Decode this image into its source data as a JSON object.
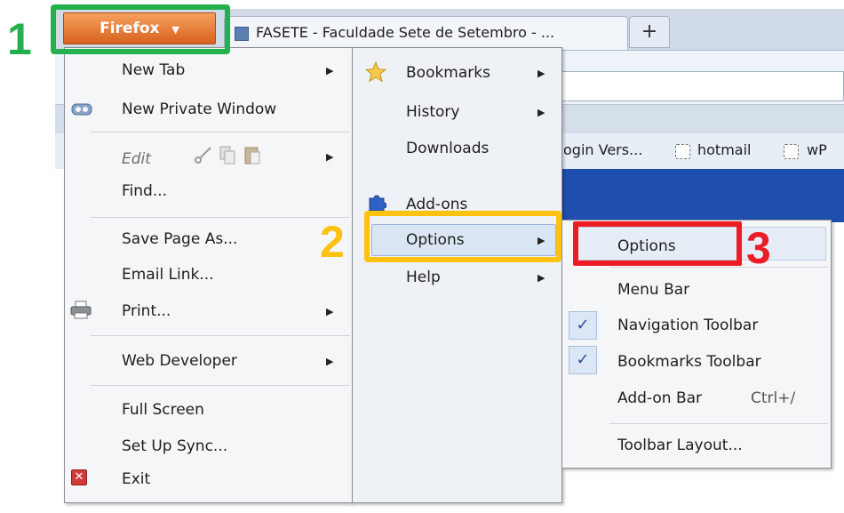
{
  "window": {
    "firefox_button_label": "Firefox",
    "tab_title": "FASETE - Faculdade Sete de Setembro - ...",
    "new_tab_symbol": "+",
    "bookmarks_toolbar_items": [
      "ogin Vers...",
      "hotmail",
      "wP"
    ]
  },
  "left_menu": {
    "new_tab": "New Tab",
    "new_private_window": "New Private Window",
    "edit": "Edit",
    "find": "Find...",
    "save_page_as": "Save Page As...",
    "email_link": "Email Link...",
    "print": "Print...",
    "web_developer": "Web Developer",
    "full_screen": "Full Screen",
    "set_up_sync": "Set Up Sync...",
    "exit": "Exit"
  },
  "middle_menu": {
    "bookmarks": "Bookmarks",
    "history": "History",
    "downloads": "Downloads",
    "addons": "Add-ons",
    "options": "Options",
    "help": "Help"
  },
  "options_submenu": {
    "options": "Options",
    "menu_bar": "Menu Bar",
    "navigation_toolbar": "Navigation Toolbar",
    "bookmarks_toolbar": "Bookmarks Toolbar",
    "addon_bar": "Add-on Bar",
    "addon_bar_shortcut": "Ctrl+/",
    "toolbar_layout": "Toolbar Layout...",
    "checked_items": [
      "Navigation Toolbar",
      "Bookmarks Toolbar"
    ]
  },
  "annotations": {
    "step1": "1",
    "step2": "2",
    "step3": "3",
    "colors": {
      "step1": "#23b14d",
      "step2": "#ffc20e",
      "step3": "#ed1c24"
    }
  },
  "icons": {
    "private_window": "mask-icon",
    "edit_cut": "scissors-icon",
    "edit_copy": "copy-icon",
    "edit_paste": "paste-icon",
    "print": "printer-icon",
    "exit": "exit-icon",
    "bookmarks": "star-icon",
    "addons": "puzzle-icon",
    "check": "checkmark-icon"
  }
}
